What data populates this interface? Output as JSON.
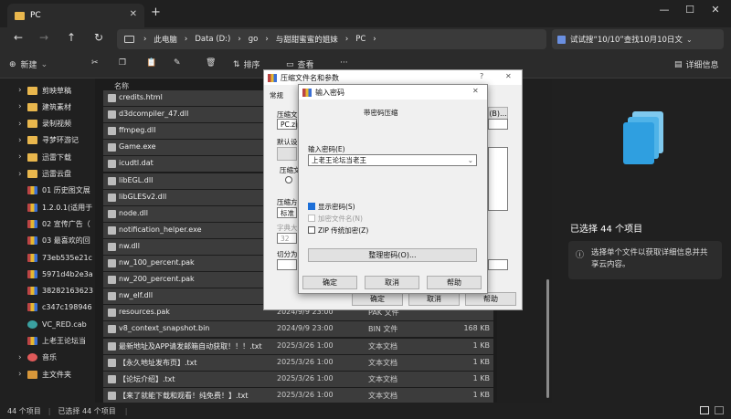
{
  "tab": {
    "title": "PC"
  },
  "breadcrumbs": [
    "此电脑",
    "Data (D:)",
    "go",
    "与甜甜蜜蜜的姐妹",
    "PC"
  ],
  "search": {
    "text": "试试搜“10/10”查找10月10日文"
  },
  "toolbar": {
    "new_label": "新建",
    "sort_label": "排序",
    "view_label": "查看",
    "details_label": "详细信息"
  },
  "sidebar": {
    "items": [
      {
        "label": "剪映草稿",
        "icon": "folder"
      },
      {
        "label": "建筑素材",
        "icon": "folder"
      },
      {
        "label": "录制视频",
        "icon": "folder"
      },
      {
        "label": "寻梦环游记",
        "icon": "folder"
      },
      {
        "label": "迅雷下载",
        "icon": "folder"
      },
      {
        "label": "迅雷云盘",
        "icon": "folder"
      },
      {
        "label": "01 历史图文展",
        "icon": "rar"
      },
      {
        "label": "1.2.0.1(适用于",
        "icon": "rar"
      },
      {
        "label": "02 宣传广告（",
        "icon": "rar"
      },
      {
        "label": "03 最喜欢的回",
        "icon": "rar"
      },
      {
        "label": "73eb535e21c",
        "icon": "rar"
      },
      {
        "label": "5971d4b2e3a",
        "icon": "rar"
      },
      {
        "label": "38282163623",
        "icon": "rar"
      },
      {
        "label": "c347c198946",
        "icon": "rar"
      },
      {
        "label": "VC_RED.cab",
        "icon": "app"
      },
      {
        "label": "上老王论坛当",
        "icon": "rar"
      },
      {
        "label": "音乐",
        "icon": "music"
      },
      {
        "label": "主文件夹",
        "icon": "home"
      }
    ]
  },
  "filelist": {
    "column_name": "名称",
    "rows": [
      {
        "name": "credits.html",
        "date": "",
        "type": "",
        "size": ""
      },
      {
        "name": "d3dcompiler_47.dll",
        "date": "",
        "type": "",
        "size": ""
      },
      {
        "name": "ffmpeg.dll",
        "date": "",
        "type": "",
        "size": ""
      },
      {
        "name": "Game.exe",
        "date": "",
        "type": "",
        "size": ""
      },
      {
        "name": "icudtl.dat",
        "date": "",
        "type": "",
        "size": ""
      },
      {
        "name": "libEGL.dll",
        "date": "",
        "type": "",
        "size": ""
      },
      {
        "name": "libGLESv2.dll",
        "date": "",
        "type": "",
        "size": ""
      },
      {
        "name": "node.dll",
        "date": "",
        "type": "",
        "size": ""
      },
      {
        "name": "notification_helper.exe",
        "date": "",
        "type": "",
        "size": ""
      },
      {
        "name": "nw.dll",
        "date": "",
        "type": "",
        "size": ""
      },
      {
        "name": "nw_100_percent.pak",
        "date": "",
        "type": "",
        "size": ""
      },
      {
        "name": "nw_200_percent.pak",
        "date": "",
        "type": "",
        "size": ""
      },
      {
        "name": "nw_elf.dll",
        "date": "",
        "type": "",
        "size": ""
      },
      {
        "name": "resources.pak",
        "date": "2024/9/9 23:00",
        "type": "PAK 文件",
        "size": ""
      },
      {
        "name": "v8_context_snapshot.bin",
        "date": "2024/9/9 23:00",
        "type": "BIN 文件",
        "size": "168 KB"
      },
      {
        "name": "最新地址及APP请发邮箱自动获取！！！.txt",
        "date": "2025/3/26 1:00",
        "type": "文本文档",
        "size": "1 KB"
      },
      {
        "name": "【永久地址发布页】.txt",
        "date": "2025/3/26 1:00",
        "type": "文本文档",
        "size": "1 KB"
      },
      {
        "name": "【论坛介绍】.txt",
        "date": "2025/3/26 1:00",
        "type": "文本文档",
        "size": "1 KB"
      },
      {
        "name": "【来了就能下载和观看！纯免费！】.txt",
        "date": "2025/3/26 1:00",
        "type": "文本文档",
        "size": "1 KB"
      }
    ]
  },
  "details": {
    "selected": "已选择 44 个项目",
    "info": "选择单个文件以获取详细信息并共享云内容。"
  },
  "status": {
    "count": "44 个项目",
    "selected": "已选择 44 个项目"
  },
  "archive_dialog": {
    "title": "压缩文件名和参数",
    "help_glyph": "?",
    "tab_general": "常规",
    "label_archive": "压缩文",
    "archive_value": "PC.zip",
    "browse_btn": "(B)...",
    "label_default": "默认设",
    "label_format": "压缩文",
    "label_method": "压缩方",
    "method_value": "标准",
    "label_dict": "字典大",
    "dict_value": "32",
    "label_split": "切分为",
    "ok": "确定",
    "cancel": "取消",
    "help": "帮助"
  },
  "password_dialog": {
    "title": "输入密码",
    "heading": "带密码压缩",
    "label_password": "输入密码(E)",
    "password_value": "上老王论坛当老王",
    "show_password": "显示密码(S)",
    "encrypt_names": "加密文件名(N)",
    "zip_legacy": "ZIP 传统加密(Z)",
    "organize_btn": "整理密码(O)...",
    "ok": "确定",
    "cancel": "取消",
    "help": "帮助"
  }
}
